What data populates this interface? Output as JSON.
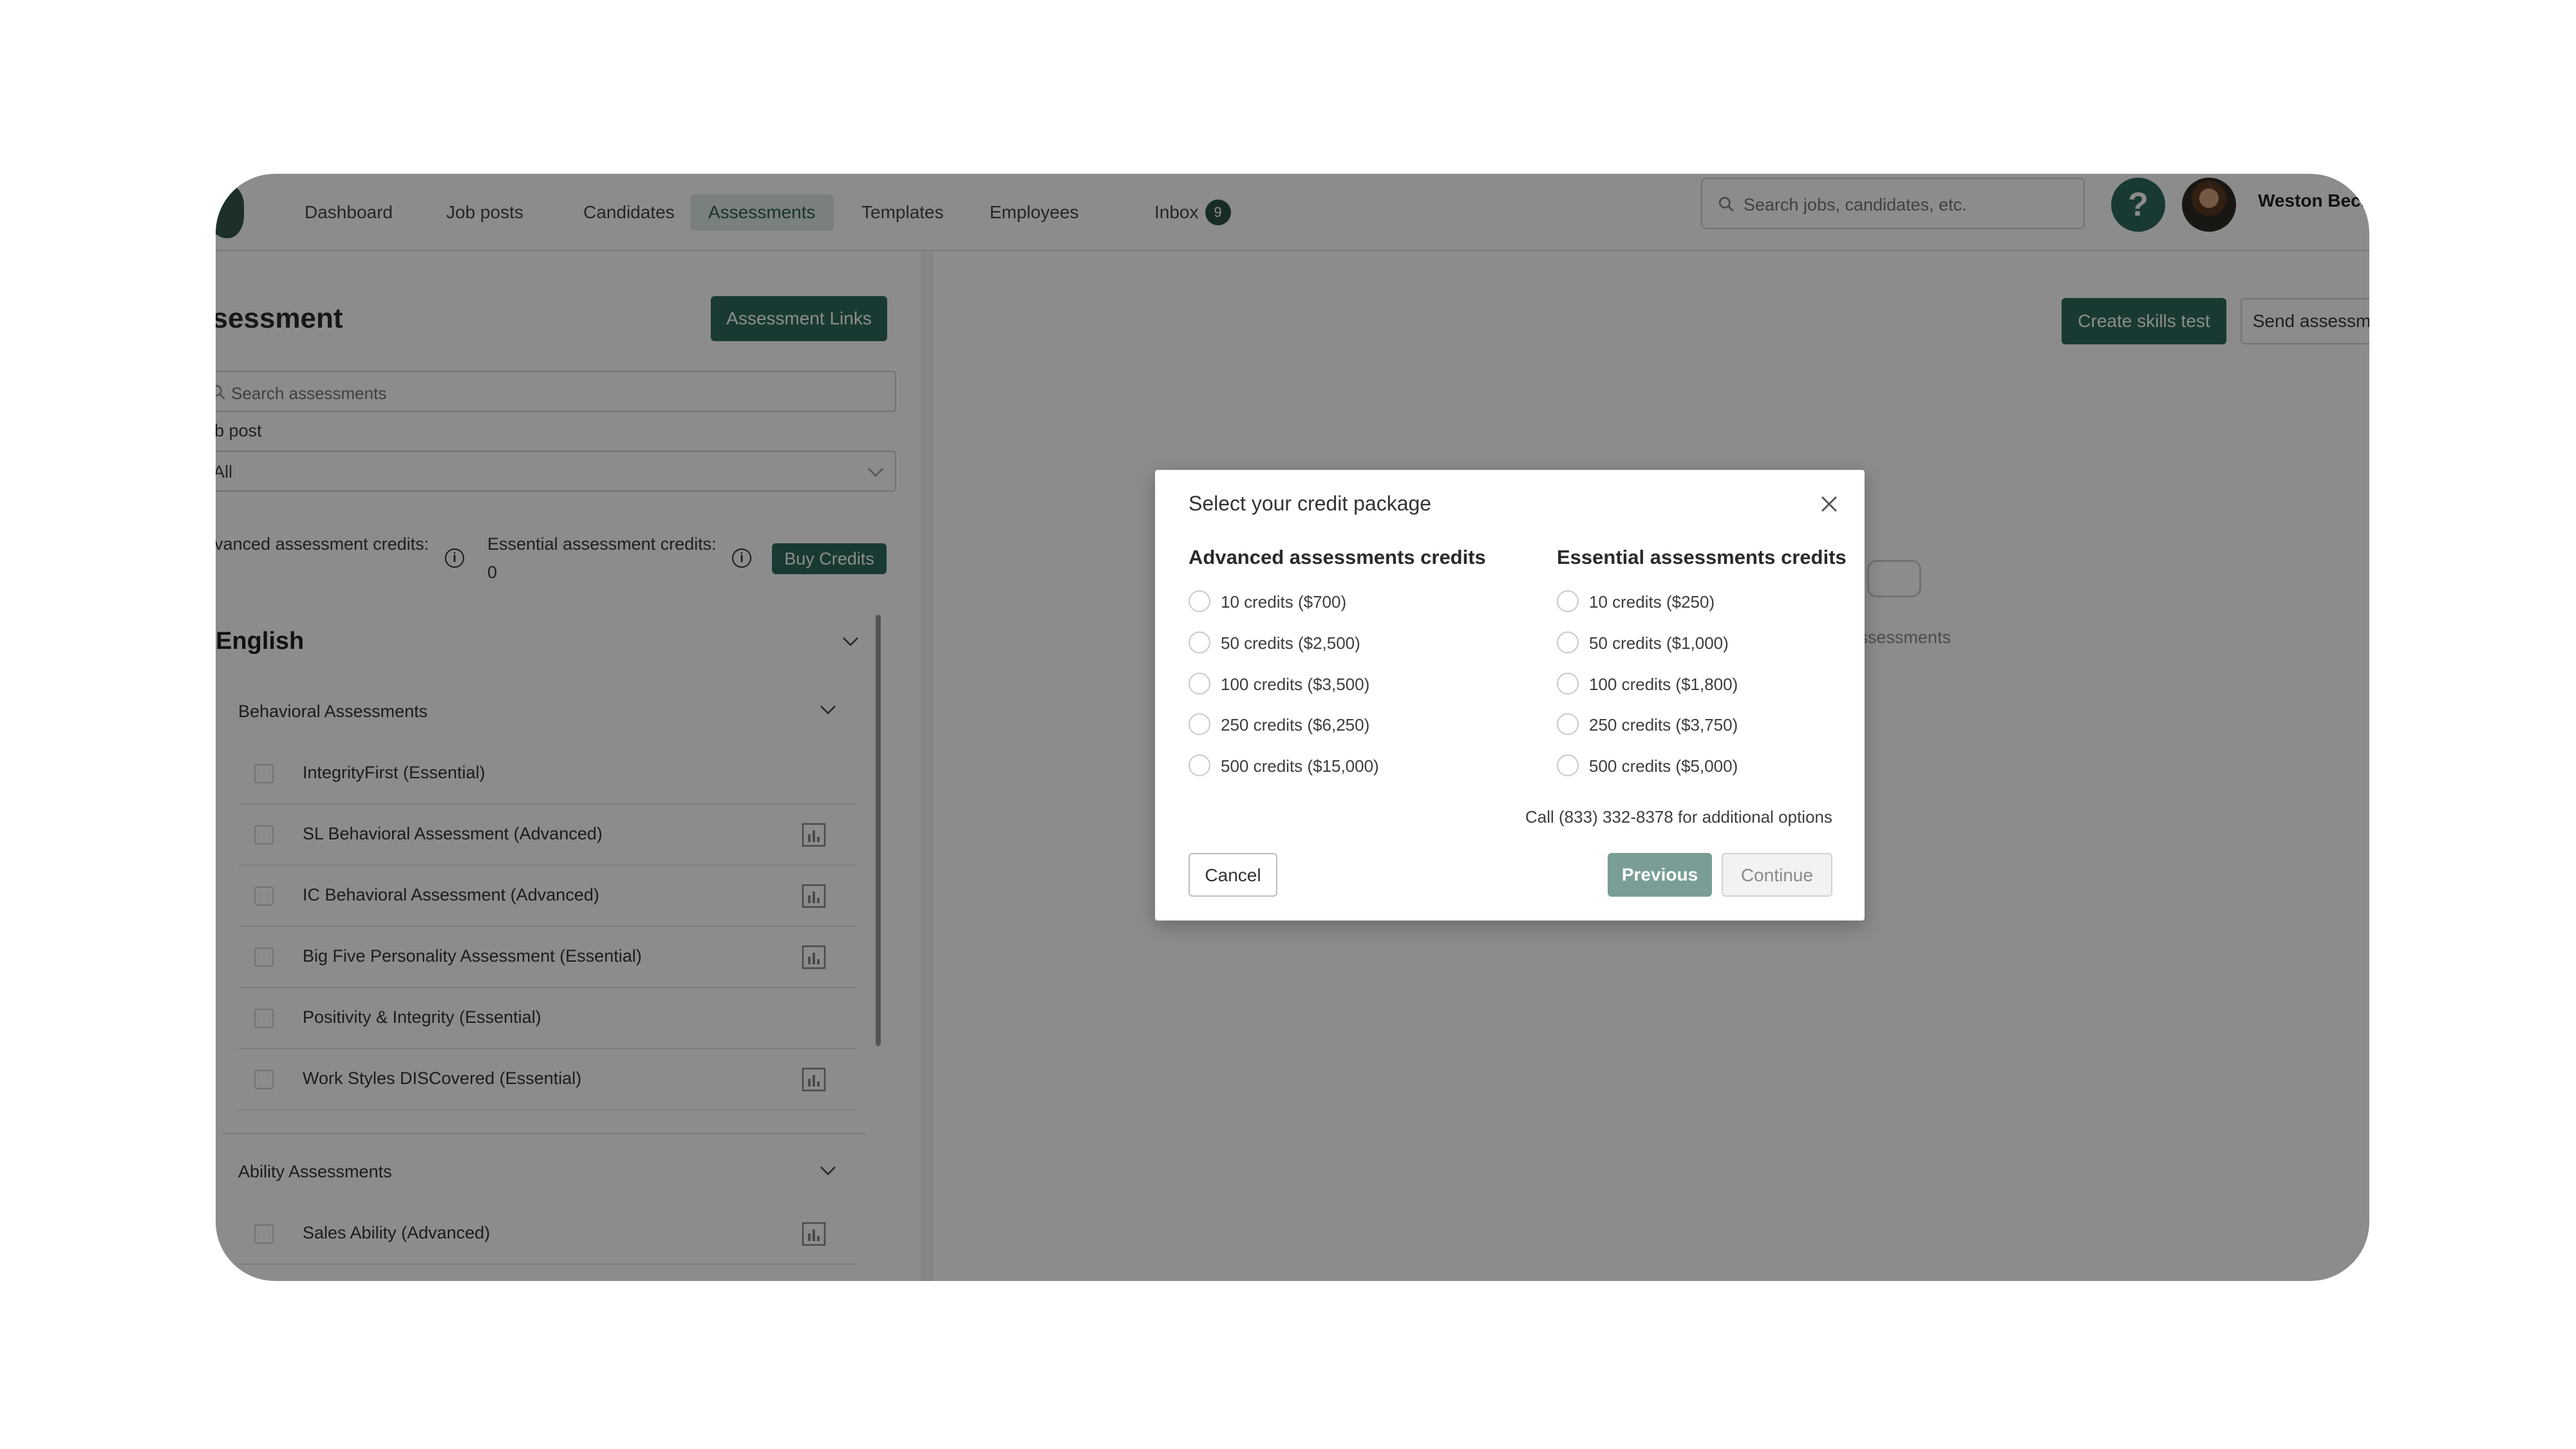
{
  "nav": {
    "items": [
      {
        "label": "Dashboard"
      },
      {
        "label": "Job posts"
      },
      {
        "label": "Candidates"
      },
      {
        "label": "Assessments",
        "active": true
      },
      {
        "label": "Templates"
      },
      {
        "label": "Employees"
      },
      {
        "label": "Inbox",
        "badge": "9"
      }
    ],
    "search_placeholder": "Search jobs, candidates, etc.",
    "help_label": "?",
    "username": "Weston Beck"
  },
  "left": {
    "title": "ssessment",
    "assessment_links_button": "Assessment Links",
    "search_placeholder": "Search assessments",
    "job_post_label": "b post",
    "job_post_value": "All",
    "advanced_credits_label": "vanced assessment credits:",
    "essential_credits_label": "Essential assessment credits:",
    "essential_credits_value": "0",
    "buy_credits_button": "Buy Credits",
    "language": "English",
    "groups": [
      {
        "name": "Behavioral Assessments",
        "items": [
          {
            "label": "IntegrityFirst  (Essential)",
            "report": false
          },
          {
            "label": "SL Behavioral Assessment  (Advanced)",
            "report": true
          },
          {
            "label": "IC Behavioral Assessment  (Advanced)",
            "report": true
          },
          {
            "label": "Big Five Personality Assessment  (Essential)",
            "report": true
          },
          {
            "label": "Positivity & Integrity  (Essential)",
            "report": false
          },
          {
            "label": "Work Styles DISCovered  (Essential)",
            "report": true
          }
        ]
      },
      {
        "name": "Ability Assessments",
        "items": [
          {
            "label": "Sales Ability  (Advanced)",
            "report": true
          }
        ]
      }
    ]
  },
  "right": {
    "create_skills_test_button": "Create skills test",
    "send_assessment_button": "Send assessment",
    "empty_text": "d assessments"
  },
  "modal": {
    "title": "Select your credit package",
    "advanced_heading": "Advanced assessments credits",
    "essential_heading": "Essential assessments credits",
    "advanced_options": [
      "10 credits ($700)",
      "50 credits ($2,500)",
      "100 credits ($3,500)",
      "250 credits ($6,250)",
      "500 credits ($15,000)"
    ],
    "essential_options": [
      "10 credits ($250)",
      "50 credits ($1,000)",
      "100 credits ($1,800)",
      "250 credits ($3,750)",
      "500 credits ($5,000)"
    ],
    "call_note": "Call (833) 332-8378 for additional options",
    "cancel_button": "Cancel",
    "previous_button": "Previous",
    "continue_button": "Continue"
  },
  "colors": {
    "brand_green": "#2f6b5c",
    "active_tab_bg": "#dceae5",
    "previous_button": "#7a9e97",
    "overlay": "rgba(0,0,0,0.45)"
  }
}
